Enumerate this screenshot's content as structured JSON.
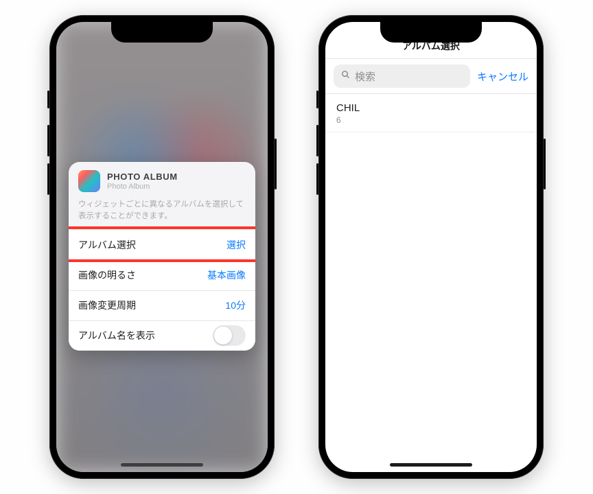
{
  "phone1": {
    "card": {
      "app_title": "PHOTO ALBUM",
      "app_subtitle": "Photo Album",
      "description": "ウィジェットごとに異なるアルバムを選択して表示することができます。",
      "rows": [
        {
          "label": "アルバム選択",
          "value": "選択",
          "type": "link"
        },
        {
          "label": "画像の明るさ",
          "value": "基本画像",
          "type": "link"
        },
        {
          "label": "画像変更周期",
          "value": "10分",
          "type": "link"
        },
        {
          "label": "アルバム名を表示",
          "value": "",
          "type": "toggle_off"
        }
      ]
    }
  },
  "phone2": {
    "title": "アルバム選択",
    "search_placeholder": "検索",
    "cancel": "キャンセル",
    "items": [
      {
        "title": "CHIL",
        "subtitle": "6"
      }
    ]
  },
  "colors": {
    "accent": "#0a7aff",
    "highlight": "#ff3428"
  }
}
